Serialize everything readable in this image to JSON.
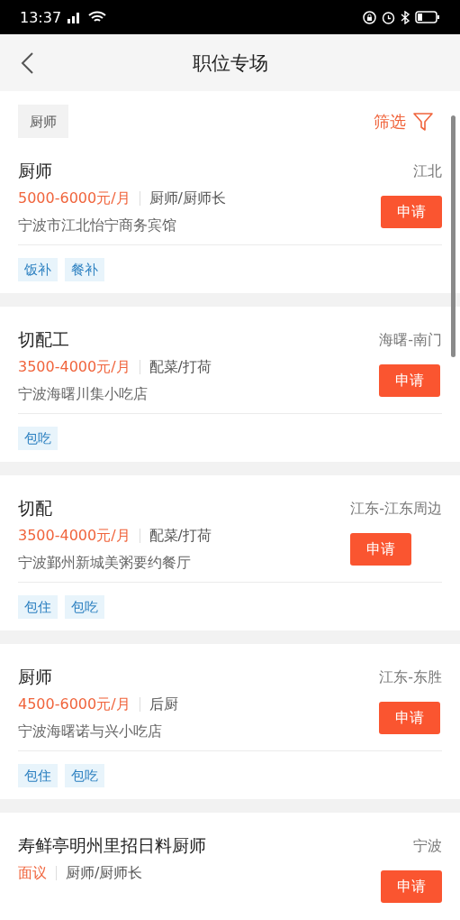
{
  "status_bar": {
    "time": "13:37"
  },
  "header": {
    "title": "职位专场"
  },
  "filter_bar": {
    "keyword": "厨师",
    "filter_label": "筛选"
  },
  "jobs": [
    {
      "title": "厨师",
      "location": "江北",
      "salary": "5000-6000元/月",
      "category": "厨师/厨师长",
      "company": "宁波市江北怡宁商务宾馆",
      "tags": [
        "饭补",
        "餐补"
      ],
      "button": "申请"
    },
    {
      "title": "切配工",
      "location": "海曙-南门",
      "salary": "3500-4000元/月",
      "category": "配菜/打荷",
      "company": "宁波海曙川集小吃店",
      "tags": [
        "包吃"
      ],
      "button": "申请"
    },
    {
      "title": "切配",
      "location": "江东-江东周边",
      "salary": "3500-4000元/月",
      "category": "配菜/打荷",
      "company": "宁波鄞州新城美粥要约餐厅",
      "tags": [
        "包住",
        "包吃"
      ],
      "button": "申请"
    },
    {
      "title": "厨师",
      "location": "江东-东胜",
      "salary": "4500-6000元/月",
      "category": "后厨",
      "company": "宁波海曙诺与兴小吃店",
      "tags": [
        "包住",
        "包吃"
      ],
      "button": "申请"
    },
    {
      "title": "寿鲜亭明州里招日料厨师",
      "location": "宁波",
      "salary": "面议",
      "category": "厨师/厨师长",
      "button": "申请"
    }
  ]
}
